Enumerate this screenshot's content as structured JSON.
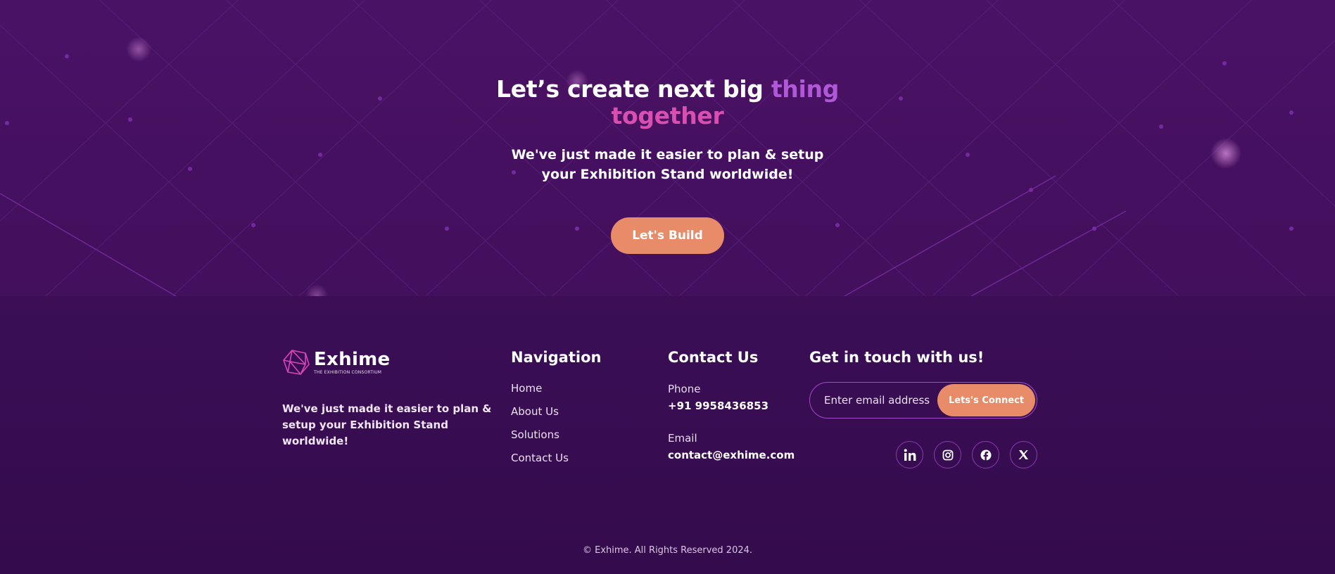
{
  "cta": {
    "title_part1": "Let’s create next big ",
    "title_highlight1": "thing",
    "title_highlight2": "together",
    "subtitle": "We've just made it easier to plan & setup your Exhibition Stand worldwide!",
    "button_label": "Let's Build"
  },
  "footer": {
    "brand": {
      "logo_icon": "polyhedron-logo-icon",
      "name": "Exhime",
      "tagline": "THE EXHIBITION CONSORTIUM",
      "description": "We've just made it easier to plan & setup your Exhibition Stand worldwide!"
    },
    "navigation": {
      "title": "Navigation",
      "items": [
        {
          "label": "Home"
        },
        {
          "label": "About Us"
        },
        {
          "label": "Solutions"
        },
        {
          "label": "Contact Us"
        }
      ]
    },
    "contact": {
      "title": "Contact Us",
      "phone_label": "Phone",
      "phone": "+91 9958436853",
      "email_label": "Email",
      "email": "contact@exhime.com"
    },
    "get_in_touch": {
      "title": "Get in touch with us!",
      "email_placeholder": "Enter email address",
      "button_label": "Lets's Connect",
      "socials": [
        {
          "icon": "linkedin-icon"
        },
        {
          "icon": "instagram-icon"
        },
        {
          "icon": "facebook-icon"
        },
        {
          "icon": "x-twitter-icon"
        }
      ]
    },
    "copyright": "© Exhime. All Rights Reserved 2024."
  },
  "colors": {
    "accent_orange": "#e88b68",
    "highlight_purple": "#b058d8",
    "highlight_pink": "#d84fb0",
    "bg_hero": "#4a1265",
    "bg_footer": "#3a0d52"
  }
}
